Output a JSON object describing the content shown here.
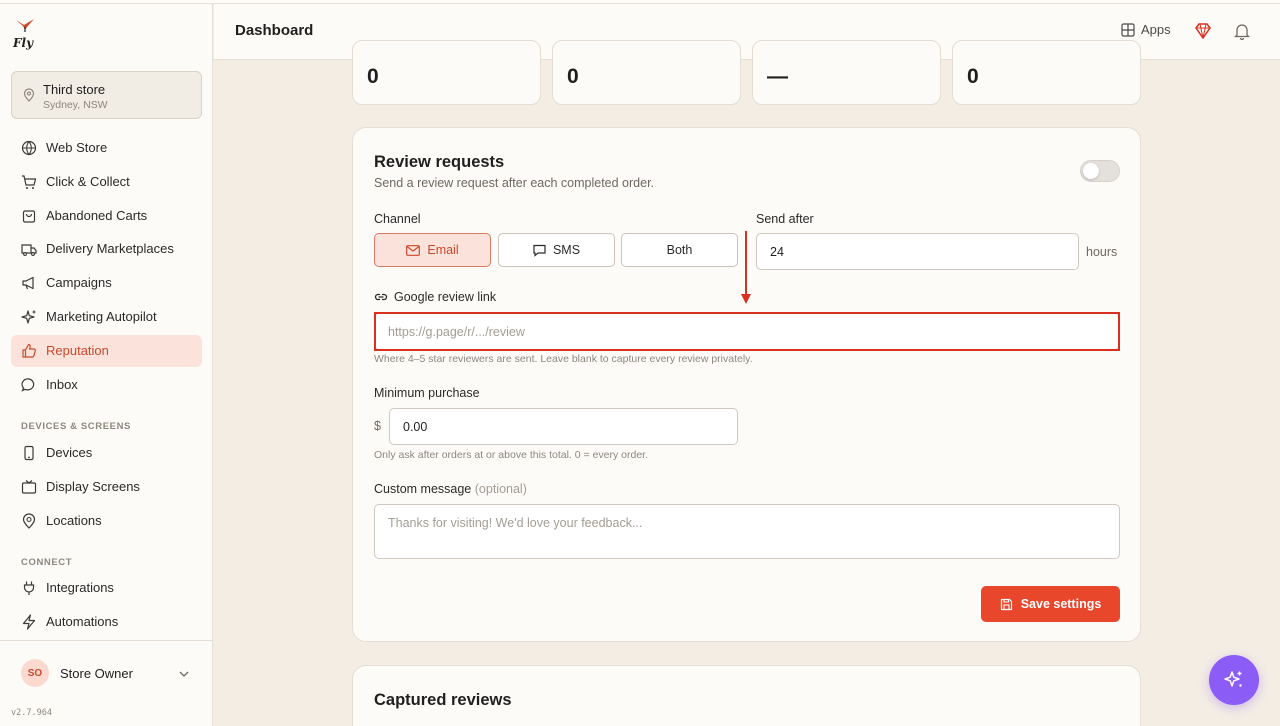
{
  "brand": {
    "logo_text": "Fly"
  },
  "header": {
    "title": "Dashboard",
    "apps_label": "Apps"
  },
  "store": {
    "name": "Third store",
    "location": "Sydney, NSW"
  },
  "nav": [
    {
      "label": "Web Store",
      "icon": "globe-icon"
    },
    {
      "label": "Click & Collect",
      "icon": "cart-icon"
    },
    {
      "label": "Abandoned Carts",
      "icon": "basket-icon"
    },
    {
      "label": "Delivery Marketplaces",
      "icon": "truck-icon"
    },
    {
      "label": "Campaigns",
      "icon": "megaphone-icon"
    },
    {
      "label": "Marketing Autopilot",
      "icon": "sparkle-icon"
    },
    {
      "label": "Reputation",
      "icon": "thumbs-up-icon",
      "active": true
    },
    {
      "label": "Inbox",
      "icon": "chat-icon"
    }
  ],
  "sections": {
    "devices": "DEVICES & SCREENS",
    "connect": "CONNECT"
  },
  "nav_devices": [
    {
      "label": "Devices",
      "icon": "phone-icon"
    },
    {
      "label": "Display Screens",
      "icon": "tv-icon"
    },
    {
      "label": "Locations",
      "icon": "map-pin-icon"
    }
  ],
  "nav_connect": [
    {
      "label": "Integrations",
      "icon": "plug-icon"
    },
    {
      "label": "Automations",
      "icon": "bolt-icon"
    }
  ],
  "user": {
    "initials": "SO",
    "name": "Store Owner"
  },
  "version": "v2.7.964",
  "stats": [
    "0",
    "0",
    "—",
    "0"
  ],
  "review": {
    "title": "Review requests",
    "subtitle": "Send a review request after each completed order.",
    "enabled": false,
    "channel_label": "Channel",
    "channels": [
      "Email",
      "SMS",
      "Both"
    ],
    "selected_channel": "Email",
    "send_after_label": "Send after",
    "send_after_value": "24",
    "hours_label": "hours",
    "google_label": "Google review link",
    "google_placeholder": "https://g.page/r/.../review",
    "google_hint": "Where 4–5 star reviewers are sent. Leave blank to capture every review privately.",
    "min_label": "Minimum purchase",
    "currency": "$",
    "min_value": "0.00",
    "min_hint": "Only ask after orders at or above this total. 0 = every order.",
    "custom_label": "Custom message",
    "optional_label": "(optional)",
    "custom_placeholder": "Thanks for visiting! We'd love your feedback...",
    "save_label": "Save settings"
  },
  "captured": {
    "title": "Captured reviews"
  },
  "colors": {
    "accent": "#e8472b",
    "active_bg": "#fbe3db",
    "fab": "#8b5cf6",
    "highlight": "#d93020"
  }
}
